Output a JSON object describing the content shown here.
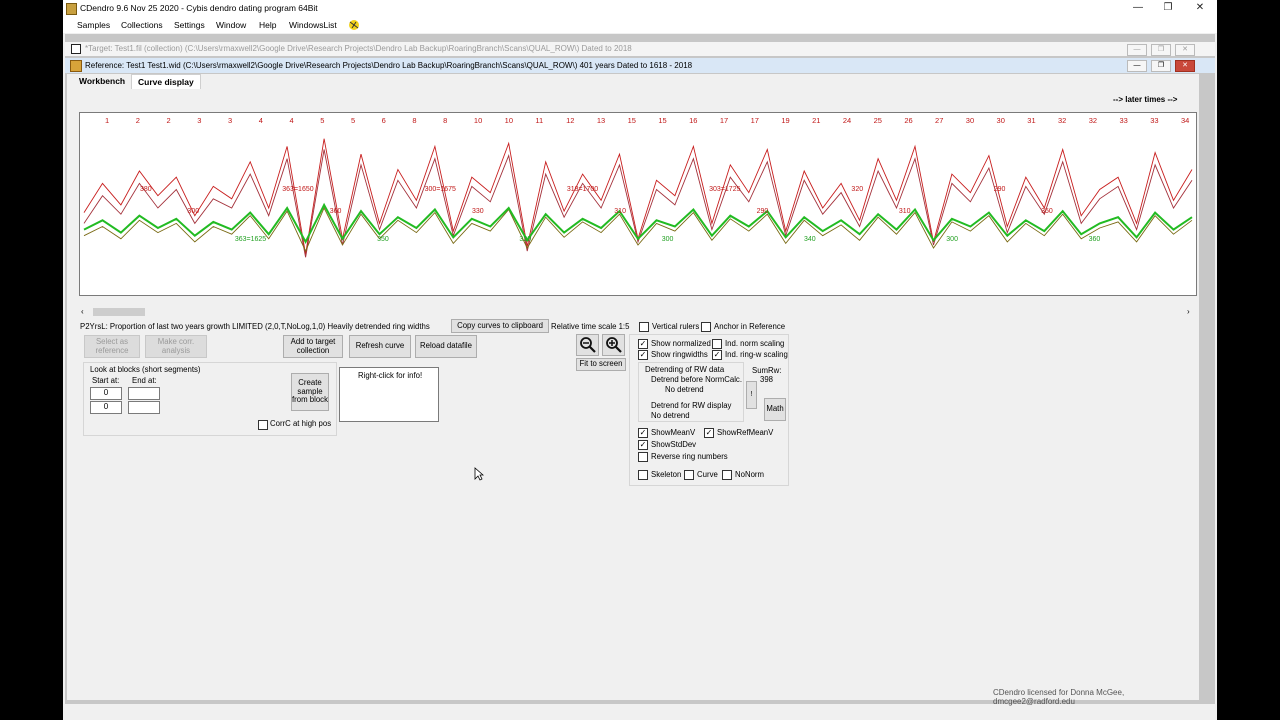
{
  "window": {
    "title": "CDendro 9.6  Nov 25 2020 - Cybis dendro dating program  64Bit",
    "minimize": "—",
    "restore": "❐",
    "close": "✕"
  },
  "menu": {
    "items": [
      "Samples",
      "Collections",
      "Settings",
      "Window",
      "Help",
      "WindowsList"
    ]
  },
  "target_window": {
    "title": "*Target: Test1.fil (collection)   (C:\\Users\\rmaxwell2\\Google Drive\\Research Projects\\Dendro Lab Backup\\RoaringBranch\\Scans\\QUAL_ROW\\)  Dated to 2018"
  },
  "reference_window": {
    "title": "Reference: Test1 Test1.wid    (C:\\Users\\rmaxwell2\\Google Drive\\Research Projects\\Dendro Lab Backup\\RoaringBranch\\Scans\\QUAL_ROW\\)  401 years  Dated to 1618 - 2018"
  },
  "tabs": [
    {
      "label": "Workbench",
      "active": false
    },
    {
      "label": "Curve display",
      "active": true
    }
  ],
  "later_times": "--> later times -->",
  "chart_data": {
    "type": "line",
    "ring_markers": [
      "1",
      "2",
      "2",
      "3",
      "3",
      "4",
      "4",
      "5",
      "5",
      "6",
      "8",
      "8",
      "10",
      "10",
      "11",
      "12",
      "13",
      "15",
      "15",
      "16",
      "17",
      "17",
      "19",
      "21",
      "24",
      "25",
      "26",
      "27",
      "30",
      "30",
      "31",
      "32",
      "32",
      "33",
      "33",
      "34"
    ],
    "annotations": [
      "380",
      "300",
      "363=1625",
      "363=1650",
      "360",
      "350",
      "300=1675",
      "330",
      "320",
      "318=1700",
      "310",
      "300",
      "303=1725",
      "290",
      "340",
      "320",
      "310",
      "300",
      "290",
      "350",
      "360"
    ],
    "series": [
      {
        "color": "#c81e1e",
        "values": [
          0.47,
          0.66,
          0.52,
          0.74,
          0.58,
          0.7,
          0.45,
          0.64,
          0.56,
          0.8,
          0.5,
          0.9,
          0.2,
          0.95,
          0.3,
          0.85,
          0.4,
          0.75,
          0.55,
          0.9,
          0.35,
          0.7,
          0.6,
          0.92,
          0.25,
          0.8,
          0.48,
          0.72,
          0.55,
          0.85,
          0.3,
          0.68,
          0.58,
          0.9,
          0.4,
          0.78,
          0.6,
          0.88,
          0.35,
          0.74,
          0.5,
          0.66,
          0.42,
          0.82,
          0.55,
          0.9,
          0.28,
          0.72,
          0.6,
          0.84,
          0.38,
          0.7,
          0.5,
          0.88,
          0.45,
          0.62,
          0.7,
          0.4,
          0.86,
          0.55,
          0.75
        ]
      },
      {
        "color": "#a4323c",
        "values": [
          0.4,
          0.58,
          0.46,
          0.66,
          0.5,
          0.62,
          0.4,
          0.56,
          0.5,
          0.72,
          0.45,
          0.82,
          0.18,
          0.88,
          0.26,
          0.78,
          0.36,
          0.68,
          0.5,
          0.82,
          0.32,
          0.64,
          0.54,
          0.84,
          0.22,
          0.72,
          0.44,
          0.66,
          0.5,
          0.78,
          0.28,
          0.62,
          0.52,
          0.82,
          0.36,
          0.7,
          0.54,
          0.8,
          0.32,
          0.68,
          0.46,
          0.6,
          0.38,
          0.74,
          0.5,
          0.82,
          0.26,
          0.66,
          0.54,
          0.76,
          0.34,
          0.64,
          0.46,
          0.8,
          0.4,
          0.56,
          0.64,
          0.36,
          0.78,
          0.5,
          0.68
        ]
      },
      {
        "color": "#7a6a14",
        "values": [
          0.32,
          0.38,
          0.3,
          0.42,
          0.34,
          0.4,
          0.28,
          0.38,
          0.33,
          0.45,
          0.3,
          0.48,
          0.22,
          0.5,
          0.26,
          0.46,
          0.3,
          0.42,
          0.34,
          0.47,
          0.27,
          0.4,
          0.35,
          0.49,
          0.24,
          0.44,
          0.31,
          0.41,
          0.34,
          0.46,
          0.26,
          0.4,
          0.35,
          0.47,
          0.29,
          0.43,
          0.35,
          0.46,
          0.27,
          0.42,
          0.32,
          0.39,
          0.29,
          0.44,
          0.33,
          0.47,
          0.24,
          0.41,
          0.35,
          0.45,
          0.28,
          0.4,
          0.32,
          0.46,
          0.3,
          0.37,
          0.41,
          0.28,
          0.45,
          0.33,
          0.42
        ]
      },
      {
        "color": "#22bb22",
        "values": [
          0.36,
          0.42,
          0.34,
          0.45,
          0.37,
          0.43,
          0.32,
          0.41,
          0.36,
          0.47,
          0.33,
          0.5,
          0.28,
          0.52,
          0.3,
          0.48,
          0.33,
          0.44,
          0.37,
          0.49,
          0.31,
          0.43,
          0.38,
          0.5,
          0.29,
          0.46,
          0.34,
          0.43,
          0.37,
          0.48,
          0.3,
          0.42,
          0.38,
          0.49,
          0.32,
          0.45,
          0.38,
          0.48,
          0.31,
          0.44,
          0.35,
          0.42,
          0.33,
          0.46,
          0.36,
          0.49,
          0.29,
          0.43,
          0.38,
          0.47,
          0.32,
          0.42,
          0.35,
          0.48,
          0.33,
          0.4,
          0.44,
          0.31,
          0.47,
          0.36,
          0.44
        ]
      }
    ]
  },
  "info_line": "P2YrsL: Proportion of last two years growth LIMITED (2,0,T,NoLog,1,0)  Heavily detrended ring widths",
  "buttons": {
    "copy_curves": "Copy curves to clipboard",
    "select_ref": "Select as reference",
    "make_corr": "Make corr. analysis",
    "add_target": "Add to target collection",
    "refresh_curve": "Refresh curve",
    "reload_datafile": "Reload datafile",
    "create_sample": "Create sample from block",
    "fit_screen": "Fit to screen",
    "math": "Math",
    "zoom_out": "−",
    "zoom_in": "+"
  },
  "relative_scale": "Relative time scale 1:5",
  "blocks": {
    "title": "Look at blocks (short segments)",
    "start_label": "Start at:",
    "end_label": "End at:",
    "start1": "0",
    "start2": "0",
    "end1": "",
    "end2": ""
  },
  "corrc_label": "CorrC at high pos",
  "info_box": "Right-click for info!",
  "options": {
    "vertical_rulers": "Vertical rulers",
    "anchor_ref": "Anchor in Reference",
    "show_normalized": "Show normalized",
    "ind_norm_scaling": "Ind. norm scaling",
    "show_ringwidths": "Show ringwidths",
    "ind_ringw_scaling": "Ind. ring-w scaling",
    "detrending_title": "Detrending of RW data",
    "detrend_before": "Detrend before NormCalc.",
    "detrend_before_value": "No detrend",
    "detrend_display": "Detrend for RW display",
    "detrend_display_value": "No detrend",
    "sumrw_label": "SumRw:",
    "sumrw_value": "398",
    "show_meanv": "ShowMeanV",
    "show_refmeanv": "ShowRefMeanV",
    "show_stddev": "ShowStdDev",
    "reverse_rings": "Reverse ring numbers",
    "skeleton": "Skeleton",
    "curve": "Curve",
    "nonorm": "NoNorm"
  },
  "status": "CDendro licensed for Donna McGee, dmcgee2@radford.edu",
  "check": "✓"
}
